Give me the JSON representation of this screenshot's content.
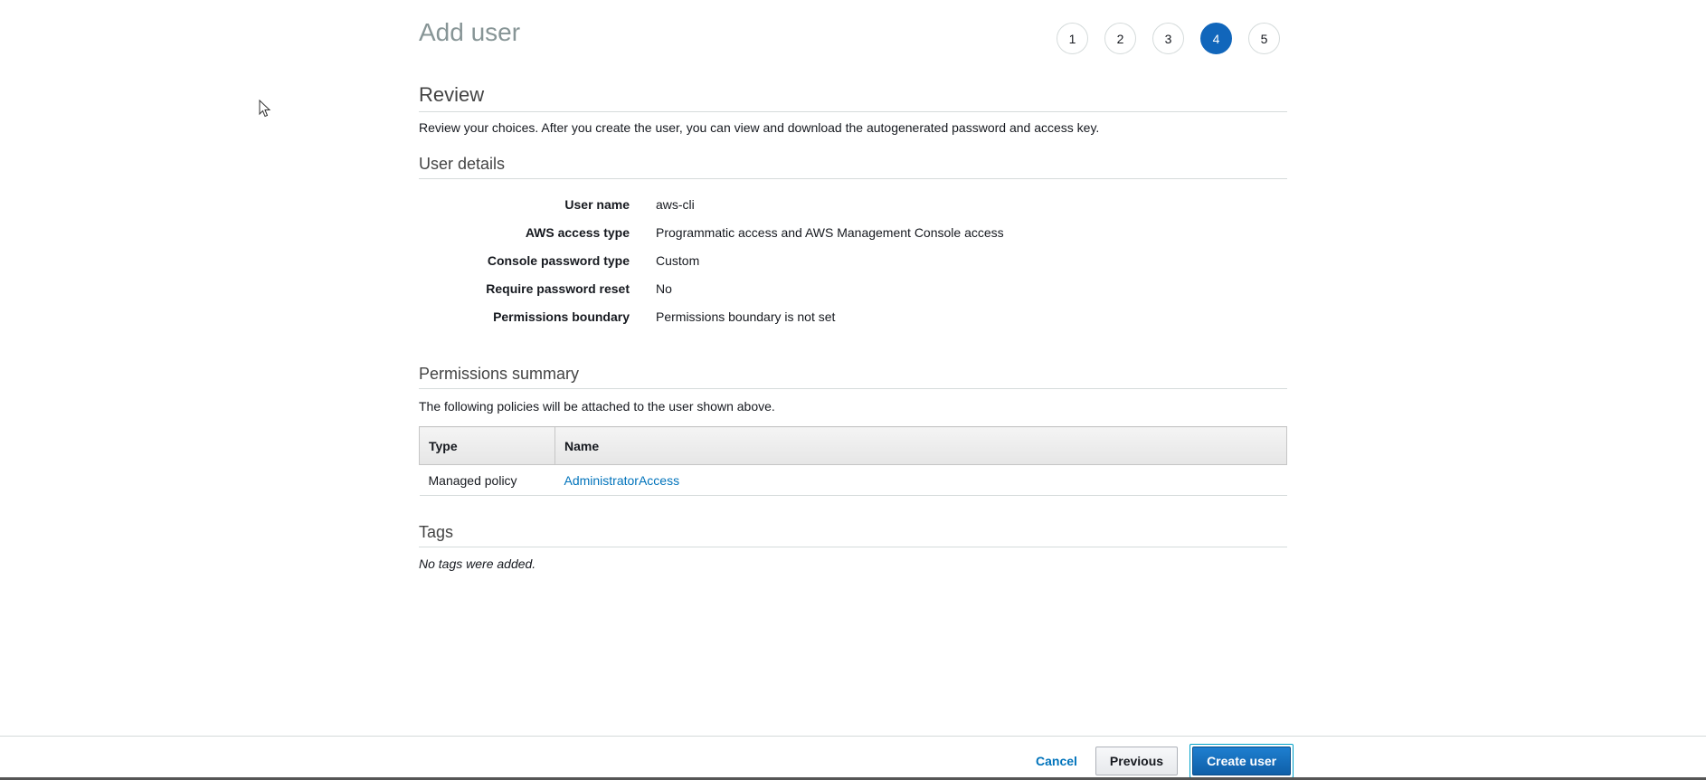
{
  "header": {
    "title": "Add user",
    "steps": [
      "1",
      "2",
      "3",
      "4",
      "5"
    ],
    "active_step": "4"
  },
  "review": {
    "title": "Review",
    "description": "Review your choices. After you create the user, you can view and download the autogenerated password and access key."
  },
  "user_details": {
    "title": "User details",
    "rows": [
      {
        "label": "User name",
        "value": "aws-cli"
      },
      {
        "label": "AWS access type",
        "value": "Programmatic access and AWS Management Console access"
      },
      {
        "label": "Console password type",
        "value": "Custom"
      },
      {
        "label": "Require password reset",
        "value": "No"
      },
      {
        "label": "Permissions boundary",
        "value": "Permissions boundary is not set"
      }
    ]
  },
  "permissions": {
    "title": "Permissions summary",
    "description": "The following policies will be attached to the user shown above.",
    "columns": [
      "Type",
      "Name"
    ],
    "rows": [
      {
        "type": "Managed policy",
        "name": "AdministratorAccess"
      }
    ]
  },
  "tags": {
    "title": "Tags",
    "empty_text": "No tags were added."
  },
  "footer": {
    "cancel_label": "Cancel",
    "previous_label": "Previous",
    "create_label": "Create user"
  },
  "colors": {
    "accent": "#1166bb",
    "link": "#0073bb"
  }
}
